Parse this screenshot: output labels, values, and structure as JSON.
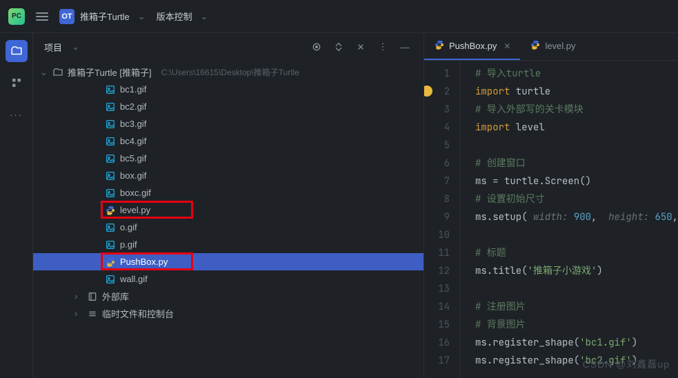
{
  "titlebar": {
    "project_name": "推箱子Turtle",
    "menu_vcs": "版本控制"
  },
  "panel": {
    "title": "项目",
    "root_label": "推箱子Turtle [推箱子]",
    "root_path": "C:\\Users\\16615\\Desktop\\推箱子Turtle",
    "files": [
      {
        "name": "bc1.gif",
        "type": "img"
      },
      {
        "name": "bc2.gif",
        "type": "img"
      },
      {
        "name": "bc3.gif",
        "type": "img"
      },
      {
        "name": "bc4.gif",
        "type": "img"
      },
      {
        "name": "bc5.gif",
        "type": "img"
      },
      {
        "name": "box.gif",
        "type": "img"
      },
      {
        "name": "boxc.gif",
        "type": "img"
      },
      {
        "name": "level.py",
        "type": "py",
        "highlight": true
      },
      {
        "name": "o.gif",
        "type": "img"
      },
      {
        "name": "p.gif",
        "type": "img"
      },
      {
        "name": "PushBox.py",
        "type": "py",
        "highlight": true,
        "selected": true
      },
      {
        "name": "wall.gif",
        "type": "img"
      }
    ],
    "ext_lib": "外部库",
    "scratch": "临时文件和控制台"
  },
  "editor": {
    "tabs": [
      {
        "label": "PushBox.py",
        "active": true,
        "closeable": true
      },
      {
        "label": "level.py",
        "active": false,
        "closeable": false
      }
    ],
    "lines": [
      {
        "n": 1,
        "html": "<span class='c-cm'># 导入turtle</span>"
      },
      {
        "n": 2,
        "html": "<span class='c-kw'>import</span> turtle",
        "bulb": true
      },
      {
        "n": 3,
        "html": "<span class='c-cm'># 导入外部写的关卡模块</span>"
      },
      {
        "n": 4,
        "html": "<span class='c-kw'>import</span> level"
      },
      {
        "n": 5,
        "html": ""
      },
      {
        "n": 6,
        "html": "<span class='c-cm'># 创建窗口</span>"
      },
      {
        "n": 7,
        "html": "ms = turtle.Screen()"
      },
      {
        "n": 8,
        "html": "<span class='c-cm'># 设置初始尺寸</span>"
      },
      {
        "n": 9,
        "html": "ms.setup( <span class='c-par'>width:</span> <span class='c-num'>900</span>,  <span class='c-par'>height:</span> <span class='c-num'>650</span>,"
      },
      {
        "n": 10,
        "html": ""
      },
      {
        "n": 11,
        "html": "<span class='c-cm'># 标题</span>"
      },
      {
        "n": 12,
        "html": "ms.title(<span class='c-str'>'推箱子小游戏'</span>)"
      },
      {
        "n": 13,
        "html": ""
      },
      {
        "n": 14,
        "html": "<span class='c-cm'># 注册图片</span>"
      },
      {
        "n": 15,
        "html": "<span class='c-cm'># 背景图片</span>"
      },
      {
        "n": 16,
        "html": "ms.register_shape(<span class='c-str'>'bc1.gif'</span>)"
      },
      {
        "n": 17,
        "html": "ms.register_shape(<span class='c-str'>'bc2.gif'</span>)"
      }
    ]
  },
  "watermark": "CSDN @刘鑫磊up"
}
